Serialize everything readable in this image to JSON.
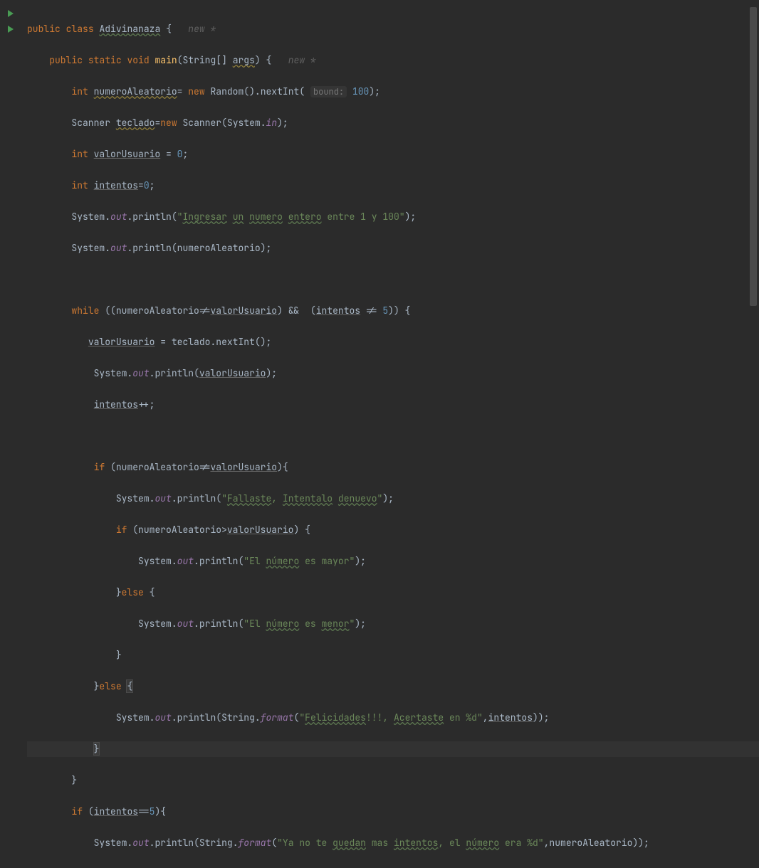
{
  "class_name": "Adivinanaza",
  "method_name": "main",
  "param_type": "String[]",
  "param_name": "args",
  "var_numeroAleatorio": "numeroAleatorio",
  "var_teclado": "teclado",
  "var_valorUsuario": "valorUsuario",
  "var_intentos": "intentos",
  "class_Random": "Random",
  "method_nextInt": "nextInt",
  "class_Scanner": "Scanner",
  "field_System": "System",
  "field_in": "in",
  "field_out": "out",
  "method_println": "println",
  "method_format": "format",
  "class_String": "String",
  "txt_new_star": "new *",
  "hint_bound": "bound:",
  "num_100": "100",
  "num_0": "0",
  "num_5": "5",
  "str_prompt": "Ingresar un numero entero entre 1 y 100",
  "str_fallaste": "Fallaste, Intentalo denuevo",
  "str_mayor_pre": "El ",
  "str_numero": "número",
  "str_mayor_post": " es mayor",
  "str_menor_post": " es menor",
  "str_felic_pre": "Felicidades!!!, ",
  "str_acertaste": "Acertaste",
  "str_felic_post": " en %d",
  "str_yano_pre": "Ya no te ",
  "str_quedan": "quedan",
  "str_yano_mid": " mas ",
  "str_intentos_w": "intentos",
  "str_yano_mid2": ", el ",
  "str_yano_post": " era %d",
  "kw_public": "public",
  "kw_class": "class",
  "kw_static": "static",
  "kw_void": "void",
  "kw_int": "int",
  "kw_new": "new",
  "kw_while": "while",
  "kw_if": "if",
  "kw_else": "else"
}
